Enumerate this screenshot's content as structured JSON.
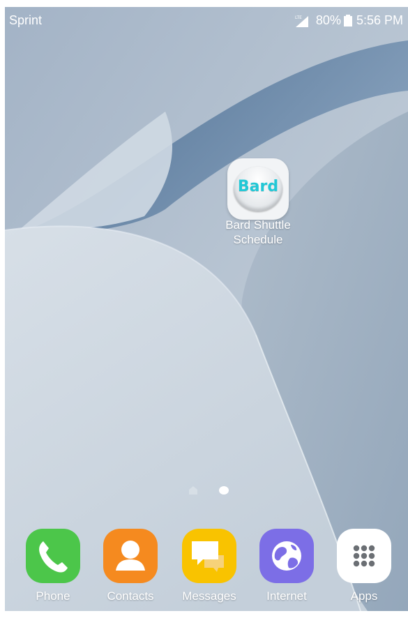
{
  "status_bar": {
    "carrier": "Sprint",
    "signal_badge": "LTE",
    "battery": "80%",
    "time": "5:56 PM"
  },
  "home": {
    "app": {
      "icon_text": "Bard",
      "label_line1": "Bard Shuttle",
      "label_line2": "Schedule",
      "accent": "#22c8d6"
    }
  },
  "dock": {
    "items": [
      {
        "label": "Phone",
        "icon": "phone-icon",
        "color": "#4cc64a"
      },
      {
        "label": "Contacts",
        "icon": "contacts-icon",
        "color": "#f58a1f"
      },
      {
        "label": "Messages",
        "icon": "messages-icon",
        "color": "#f9c300"
      },
      {
        "label": "Internet",
        "icon": "internet-icon",
        "color": "#7c6ee6"
      },
      {
        "label": "Apps",
        "icon": "apps-grid-icon",
        "color": "#ffffff"
      }
    ]
  }
}
